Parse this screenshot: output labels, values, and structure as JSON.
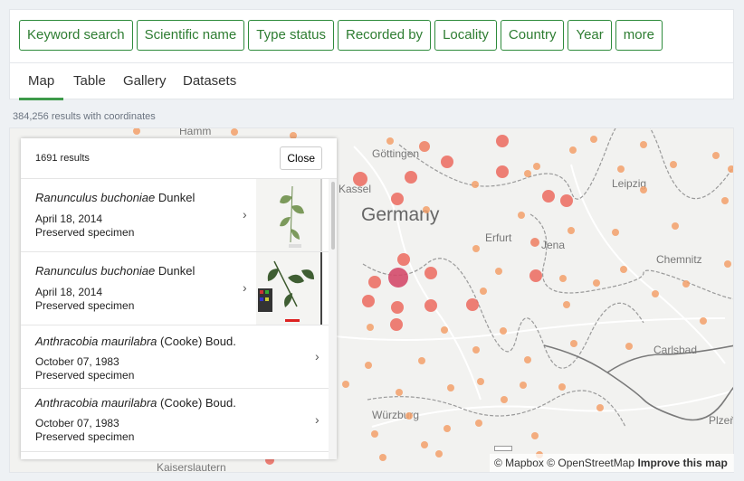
{
  "filters": [
    "Keyword search",
    "Scientific name",
    "Type status",
    "Recorded by",
    "Locality",
    "Country",
    "Year",
    "more"
  ],
  "tabs": [
    {
      "label": "Map",
      "active": true
    },
    {
      "label": "Table",
      "active": false
    },
    {
      "label": "Gallery",
      "active": false
    },
    {
      "label": "Datasets",
      "active": false
    }
  ],
  "results_with_coordinates": "384,256 results with coordinates",
  "popup": {
    "count_label": "1691 results",
    "close_label": "Close",
    "records": [
      {
        "scientific_name": "Ranunculus buchoniae",
        "author": "Dunkel",
        "date": "April 18, 2014",
        "basis": "Preserved specimen",
        "has_thumbnail": true
      },
      {
        "scientific_name": "Ranunculus buchoniae",
        "author": "Dunkel",
        "date": "April 18, 2014",
        "basis": "Preserved specimen",
        "has_thumbnail": true
      },
      {
        "scientific_name": "Anthracobia maurilabra",
        "author": "(Cooke) Boud.",
        "date": "October 07, 1983",
        "basis": "Preserved specimen",
        "has_thumbnail": false
      },
      {
        "scientific_name": "Anthracobia maurilabra",
        "author": "(Cooke) Boud.",
        "date": "October 07, 1983",
        "basis": "Preserved specimen",
        "has_thumbnail": false
      }
    ]
  },
  "map_labels": {
    "country": "Germany",
    "cities": [
      "Hamm",
      "Göttingen",
      "Kassel",
      "Leipzig",
      "Erfurt",
      "Jena",
      "Chemnitz",
      "Carlsbad",
      "Würzburg",
      "Plzeň",
      "Kaiserslautern"
    ]
  },
  "attribution": {
    "mapbox": "© Mapbox",
    "osm": "© OpenStreetMap",
    "improve": "Improve this map"
  },
  "colors": {
    "accent_green": "#2e7d32",
    "marker_fill": "#f08a5d",
    "marker_dark": "#e06060",
    "selected_marker": "#d44a6a"
  },
  "icons": {
    "row_chevron": "chevron-right-icon"
  }
}
